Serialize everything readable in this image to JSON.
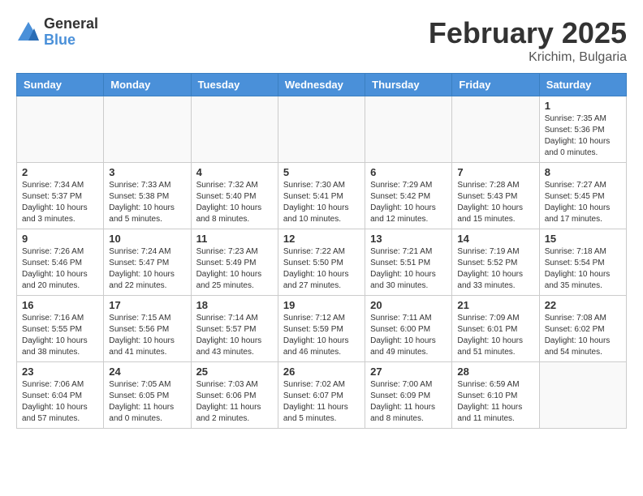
{
  "header": {
    "logo_general": "General",
    "logo_blue": "Blue",
    "month_title": "February 2025",
    "location": "Krichim, Bulgaria"
  },
  "days_of_week": [
    "Sunday",
    "Monday",
    "Tuesday",
    "Wednesday",
    "Thursday",
    "Friday",
    "Saturday"
  ],
  "weeks": [
    [
      {
        "day": "",
        "info": ""
      },
      {
        "day": "",
        "info": ""
      },
      {
        "day": "",
        "info": ""
      },
      {
        "day": "",
        "info": ""
      },
      {
        "day": "",
        "info": ""
      },
      {
        "day": "",
        "info": ""
      },
      {
        "day": "1",
        "info": "Sunrise: 7:35 AM\nSunset: 5:36 PM\nDaylight: 10 hours\nand 0 minutes."
      }
    ],
    [
      {
        "day": "2",
        "info": "Sunrise: 7:34 AM\nSunset: 5:37 PM\nDaylight: 10 hours\nand 3 minutes."
      },
      {
        "day": "3",
        "info": "Sunrise: 7:33 AM\nSunset: 5:38 PM\nDaylight: 10 hours\nand 5 minutes."
      },
      {
        "day": "4",
        "info": "Sunrise: 7:32 AM\nSunset: 5:40 PM\nDaylight: 10 hours\nand 8 minutes."
      },
      {
        "day": "5",
        "info": "Sunrise: 7:30 AM\nSunset: 5:41 PM\nDaylight: 10 hours\nand 10 minutes."
      },
      {
        "day": "6",
        "info": "Sunrise: 7:29 AM\nSunset: 5:42 PM\nDaylight: 10 hours\nand 12 minutes."
      },
      {
        "day": "7",
        "info": "Sunrise: 7:28 AM\nSunset: 5:43 PM\nDaylight: 10 hours\nand 15 minutes."
      },
      {
        "day": "8",
        "info": "Sunrise: 7:27 AM\nSunset: 5:45 PM\nDaylight: 10 hours\nand 17 minutes."
      }
    ],
    [
      {
        "day": "9",
        "info": "Sunrise: 7:26 AM\nSunset: 5:46 PM\nDaylight: 10 hours\nand 20 minutes."
      },
      {
        "day": "10",
        "info": "Sunrise: 7:24 AM\nSunset: 5:47 PM\nDaylight: 10 hours\nand 22 minutes."
      },
      {
        "day": "11",
        "info": "Sunrise: 7:23 AM\nSunset: 5:49 PM\nDaylight: 10 hours\nand 25 minutes."
      },
      {
        "day": "12",
        "info": "Sunrise: 7:22 AM\nSunset: 5:50 PM\nDaylight: 10 hours\nand 27 minutes."
      },
      {
        "day": "13",
        "info": "Sunrise: 7:21 AM\nSunset: 5:51 PM\nDaylight: 10 hours\nand 30 minutes."
      },
      {
        "day": "14",
        "info": "Sunrise: 7:19 AM\nSunset: 5:52 PM\nDaylight: 10 hours\nand 33 minutes."
      },
      {
        "day": "15",
        "info": "Sunrise: 7:18 AM\nSunset: 5:54 PM\nDaylight: 10 hours\nand 35 minutes."
      }
    ],
    [
      {
        "day": "16",
        "info": "Sunrise: 7:16 AM\nSunset: 5:55 PM\nDaylight: 10 hours\nand 38 minutes."
      },
      {
        "day": "17",
        "info": "Sunrise: 7:15 AM\nSunset: 5:56 PM\nDaylight: 10 hours\nand 41 minutes."
      },
      {
        "day": "18",
        "info": "Sunrise: 7:14 AM\nSunset: 5:57 PM\nDaylight: 10 hours\nand 43 minutes."
      },
      {
        "day": "19",
        "info": "Sunrise: 7:12 AM\nSunset: 5:59 PM\nDaylight: 10 hours\nand 46 minutes."
      },
      {
        "day": "20",
        "info": "Sunrise: 7:11 AM\nSunset: 6:00 PM\nDaylight: 10 hours\nand 49 minutes."
      },
      {
        "day": "21",
        "info": "Sunrise: 7:09 AM\nSunset: 6:01 PM\nDaylight: 10 hours\nand 51 minutes."
      },
      {
        "day": "22",
        "info": "Sunrise: 7:08 AM\nSunset: 6:02 PM\nDaylight: 10 hours\nand 54 minutes."
      }
    ],
    [
      {
        "day": "23",
        "info": "Sunrise: 7:06 AM\nSunset: 6:04 PM\nDaylight: 10 hours\nand 57 minutes."
      },
      {
        "day": "24",
        "info": "Sunrise: 7:05 AM\nSunset: 6:05 PM\nDaylight: 11 hours\nand 0 minutes."
      },
      {
        "day": "25",
        "info": "Sunrise: 7:03 AM\nSunset: 6:06 PM\nDaylight: 11 hours\nand 2 minutes."
      },
      {
        "day": "26",
        "info": "Sunrise: 7:02 AM\nSunset: 6:07 PM\nDaylight: 11 hours\nand 5 minutes."
      },
      {
        "day": "27",
        "info": "Sunrise: 7:00 AM\nSunset: 6:09 PM\nDaylight: 11 hours\nand 8 minutes."
      },
      {
        "day": "28",
        "info": "Sunrise: 6:59 AM\nSunset: 6:10 PM\nDaylight: 11 hours\nand 11 minutes."
      },
      {
        "day": "",
        "info": ""
      }
    ]
  ]
}
